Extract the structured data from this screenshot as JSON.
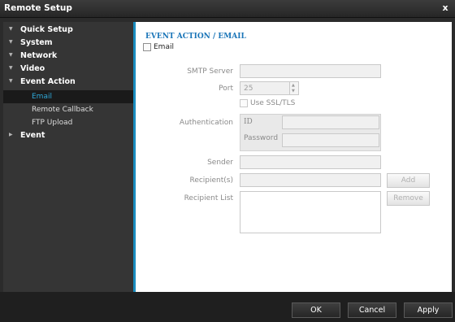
{
  "window": {
    "title": "Remote Setup",
    "close_glyph": "x"
  },
  "sidebar": {
    "items": [
      {
        "label": "Quick Setup",
        "icon": "triangle-down-icon"
      },
      {
        "label": "System",
        "icon": "triangle-down-icon"
      },
      {
        "label": "Network",
        "icon": "triangle-down-icon"
      },
      {
        "label": "Video",
        "icon": "triangle-down-icon"
      },
      {
        "label": "Event Action",
        "icon": "triangle-down-icon",
        "children": [
          {
            "label": "Email",
            "active": true
          },
          {
            "label": "Remote Callback"
          },
          {
            "label": "FTP Upload"
          }
        ]
      },
      {
        "label": "Event",
        "icon": "triangle-right-icon"
      }
    ]
  },
  "main": {
    "section_title": "EVENT ACTION / EMAIL",
    "email_checkbox": {
      "label": "Email",
      "checked": false
    },
    "smtp_server": {
      "label": "SMTP Server",
      "value": ""
    },
    "port": {
      "label": "Port",
      "value": "25"
    },
    "ssl_checkbox": {
      "label": "Use SSL/TLS",
      "checked": false
    },
    "authentication": {
      "label": "Authentication",
      "id_label": "ID",
      "id_value": "",
      "password_label": "Password",
      "password_value": ""
    },
    "sender": {
      "label": "Sender",
      "value": ""
    },
    "recipients": {
      "label": "Recipient(s)",
      "value": "",
      "add_label": "Add"
    },
    "recipient_list": {
      "label": "Recipient List",
      "remove_label": "Remove"
    }
  },
  "footer": {
    "ok": "OK",
    "cancel": "Cancel",
    "apply": "Apply"
  },
  "colors": {
    "accent": "#1a8dbf",
    "active_item": "#2fa8d8",
    "section_title": "#1a75b8"
  }
}
